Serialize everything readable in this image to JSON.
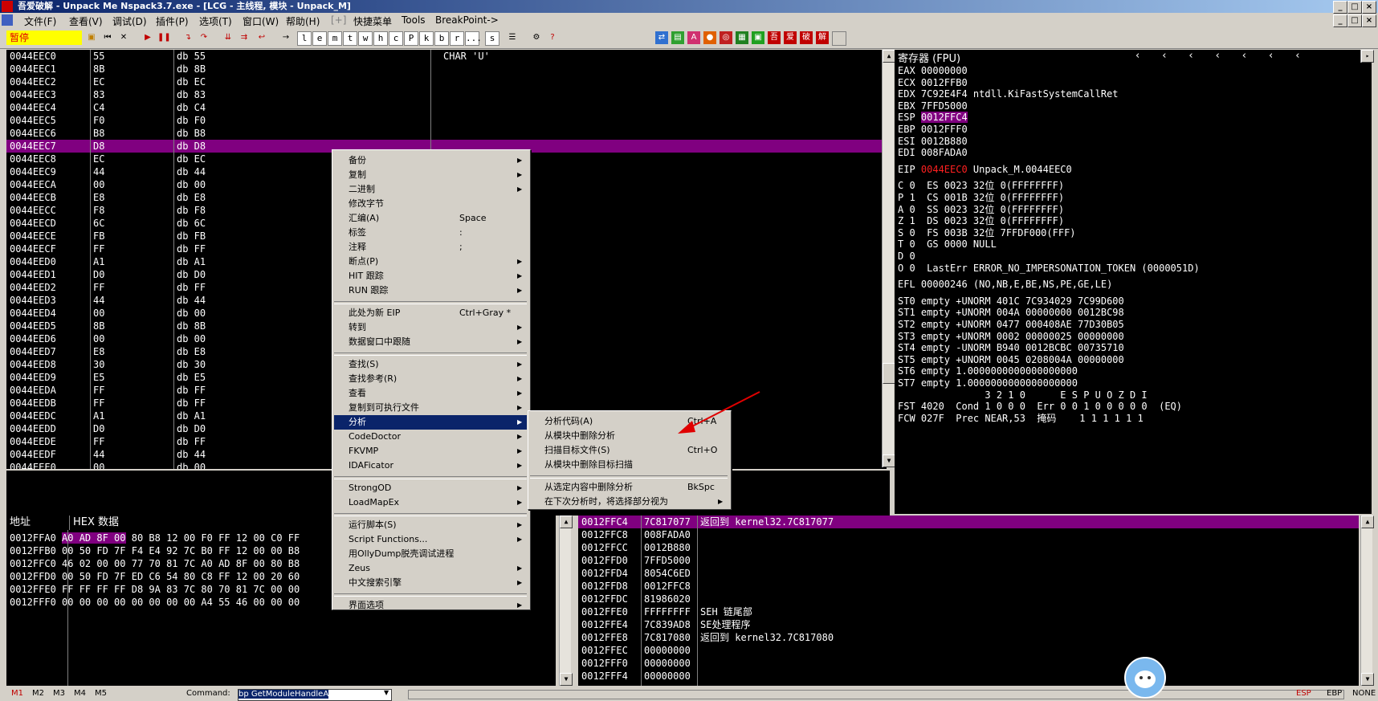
{
  "window": {
    "title": "吾爱破解 - Unpack Me Nspack3.7.exe - [LCG - 主线程, 模块 - Unpack_M]"
  },
  "menu": [
    "文件(F)",
    "查看(V)",
    "调试(D)",
    "插件(P)",
    "选项(T)",
    "窗口(W)",
    "帮助(H)",
    "[+]",
    "快捷菜单",
    "Tools",
    "BreakPoint->"
  ],
  "toolbar": {
    "status": "暂停",
    "letters": [
      "l",
      "e",
      "m",
      "t",
      "w",
      "h",
      "c",
      "P",
      "k",
      "b",
      "r",
      "...",
      "s"
    ]
  },
  "cpu": {
    "rows": [
      {
        "addr": "0044EEC0",
        "hex": "55",
        "dis": "db 55",
        "cmt": "CHAR 'U'"
      },
      {
        "addr": "0044EEC1",
        "hex": "8B",
        "dis": "db 8B",
        "cmt": ""
      },
      {
        "addr": "0044EEC2",
        "hex": "EC",
        "dis": "db EC",
        "cmt": ""
      },
      {
        "addr": "0044EEC3",
        "hex": "83",
        "dis": "db 83",
        "cmt": ""
      },
      {
        "addr": "0044EEC4",
        "hex": "C4",
        "dis": "db C4",
        "cmt": ""
      },
      {
        "addr": "0044EEC5",
        "hex": "F0",
        "dis": "db F0",
        "cmt": ""
      },
      {
        "addr": "0044EEC6",
        "hex": "B8",
        "dis": "db B8",
        "cmt": ""
      },
      {
        "addr": "0044EEC7",
        "hex": "D8",
        "dis": "db D8",
        "cmt": ""
      },
      {
        "addr": "0044EEC8",
        "hex": "EC",
        "dis": "db EC",
        "cmt": ""
      },
      {
        "addr": "0044EEC9",
        "hex": "44",
        "dis": "db 44",
        "cmt": ""
      },
      {
        "addr": "0044EECA",
        "hex": "00",
        "dis": "db 00",
        "cmt": ""
      },
      {
        "addr": "0044EECB",
        "hex": "E8",
        "dis": "db E8",
        "cmt": ""
      },
      {
        "addr": "0044EECC",
        "hex": "F8",
        "dis": "db F8",
        "cmt": ""
      },
      {
        "addr": "0044EECD",
        "hex": "6C",
        "dis": "db 6C",
        "cmt": ""
      },
      {
        "addr": "0044EECE",
        "hex": "FB",
        "dis": "db FB",
        "cmt": ""
      },
      {
        "addr": "0044EECF",
        "hex": "FF",
        "dis": "db FF",
        "cmt": ""
      },
      {
        "addr": "0044EED0",
        "hex": "A1",
        "dis": "db A1",
        "cmt": ""
      },
      {
        "addr": "0044EED1",
        "hex": "D0",
        "dis": "db D0",
        "cmt": ""
      },
      {
        "addr": "0044EED2",
        "hex": "FF",
        "dis": "db FF",
        "cmt": ""
      },
      {
        "addr": "0044EED3",
        "hex": "44",
        "dis": "db 44",
        "cmt": ""
      },
      {
        "addr": "0044EED4",
        "hex": "00",
        "dis": "db 00",
        "cmt": ""
      },
      {
        "addr": "0044EED5",
        "hex": "8B",
        "dis": "db 8B",
        "cmt": ""
      },
      {
        "addr": "0044EED6",
        "hex": "00",
        "dis": "db 00",
        "cmt": ""
      },
      {
        "addr": "0044EED7",
        "hex": "E8",
        "dis": "db E8",
        "cmt": ""
      },
      {
        "addr": "0044EED8",
        "hex": "30",
        "dis": "db 30",
        "cmt": ""
      },
      {
        "addr": "0044EED9",
        "hex": "E5",
        "dis": "db E5",
        "cmt": ""
      },
      {
        "addr": "0044EEDA",
        "hex": "FF",
        "dis": "db FF",
        "cmt": ""
      },
      {
        "addr": "0044EEDB",
        "hex": "FF",
        "dis": "db FF",
        "cmt": ""
      },
      {
        "addr": "0044EEDC",
        "hex": "A1",
        "dis": "db A1",
        "cmt": ""
      },
      {
        "addr": "0044EEDD",
        "hex": "D0",
        "dis": "db D0",
        "cmt": ""
      },
      {
        "addr": "0044EEDE",
        "hex": "FF",
        "dis": "db FF",
        "cmt": ""
      },
      {
        "addr": "0044EEDF",
        "hex": "44",
        "dis": "db 44",
        "cmt": ""
      },
      {
        "addr": "0044EEE0",
        "hex": "00",
        "dis": "db 00",
        "cmt": ""
      }
    ],
    "selected_index": 7
  },
  "registers": {
    "header": "寄存器 (FPU)",
    "lines": [
      "EAX 00000000",
      "ECX 0012FFB0",
      "EDX 7C92E4F4 ntdll.KiFastSystemCallRet",
      "EBX 7FFD5000",
      "ESP 0012FFC4",
      "EBP 0012FFF0",
      "ESI 0012B880",
      "EDI 008FADA0",
      "",
      "EIP 0044EEC0 Unpack_M.0044EEC0",
      "",
      "C 0  ES 0023 32位 0(FFFFFFFF)",
      "P 1  CS 001B 32位 0(FFFFFFFF)",
      "A 0  SS 0023 32位 0(FFFFFFFF)",
      "Z 1  DS 0023 32位 0(FFFFFFFF)",
      "S 0  FS 003B 32位 7FFDF000(FFF)",
      "T 0  GS 0000 NULL",
      "D 0",
      "O 0  LastErr ERROR_NO_IMPERSONATION_TOKEN (0000051D)",
      "",
      "EFL 00000246 (NO,NB,E,BE,NS,PE,GE,LE)",
      "",
      "ST0 empty +UNORM 401C 7C934029 7C99D600",
      "ST1 empty +UNORM 004A 00000000 0012BC98",
      "ST2 empty +UNORM 0477 000408AE 77D30B05",
      "ST3 empty +UNORM 0002 00000025 00000000",
      "ST4 empty -UNORM B940 0012BCBC 00735710",
      "ST5 empty +UNORM 0045 0208004A 00000000",
      "ST6 empty 1.0000000000000000000",
      "ST7 empty 1.0000000000000000000",
      "               3 2 1 0      E S P U O Z D I",
      "FST 4020  Cond 1 0 0 0  Err 0 0 1 0 0 0 0 0  (EQ)",
      "FCW 027F  Prec NEAR,53  掩码    1 1 1 1 1 1"
    ]
  },
  "dump": {
    "col_addr": "地址",
    "col_hex": "HEX 数据",
    "rows": [
      "0012FFA0 A0 AD 8F 00 80 B8 12 00 F0 FF 12 00 C0 FF",
      "0012FFB0 00 50 FD 7F F4 E4 92 7C B0 FF 12 00 00 B8",
      "0012FFC0 46 02 00 00 77 70 81 7C A0 AD 8F 00 80 B8",
      "0012FFD0 00 50 FD 7F ED C6 54 80 C8 FF 12 00 20 60",
      "0012FFE0 FF FF FF FF D8 9A 83 7C 80 70 81 7C 00 00",
      "0012FFF0 00 00 00 00 00 00 00 00 A4 55 46 00 00 00"
    ]
  },
  "stack": {
    "rows": [
      {
        "addr": "0012FFC4",
        "val": "7C817077",
        "cmt": "返回到 kernel32.7C817077"
      },
      {
        "addr": "0012FFC8",
        "val": "008FADA0",
        "cmt": ""
      },
      {
        "addr": "0012FFCC",
        "val": "0012B880",
        "cmt": ""
      },
      {
        "addr": "0012FFD0",
        "val": "7FFD5000",
        "cmt": ""
      },
      {
        "addr": "0012FFD4",
        "val": "8054C6ED",
        "cmt": ""
      },
      {
        "addr": "0012FFD8",
        "val": "0012FFC8",
        "cmt": ""
      },
      {
        "addr": "0012FFDC",
        "val": "81986020",
        "cmt": ""
      },
      {
        "addr": "0012FFE0",
        "val": "FFFFFFFF",
        "cmt": "SEH 链尾部"
      },
      {
        "addr": "0012FFE4",
        "val": "7C839AD8",
        "cmt": "SE处理程序"
      },
      {
        "addr": "0012FFE8",
        "val": "7C817080",
        "cmt": "返回到 kernel32.7C817080"
      },
      {
        "addr": "0012FFEC",
        "val": "00000000",
        "cmt": ""
      },
      {
        "addr": "0012FFF0",
        "val": "00000000",
        "cmt": ""
      },
      {
        "addr": "0012FFF4",
        "val": "00000000",
        "cmt": ""
      }
    ]
  },
  "context_menu": {
    "items": [
      {
        "label": "备份",
        "shortcut": "",
        "sub": true
      },
      {
        "label": "复制",
        "shortcut": "",
        "sub": true
      },
      {
        "label": "二进制",
        "shortcut": "",
        "sub": true
      },
      {
        "label": "修改字节",
        "shortcut": "",
        "sub": false
      },
      {
        "label": "汇编(A)",
        "shortcut": "Space",
        "sub": false
      },
      {
        "label": "标签",
        "shortcut": ":",
        "sub": false
      },
      {
        "label": "注释",
        "shortcut": ";",
        "sub": false
      },
      {
        "label": "断点(P)",
        "shortcut": "",
        "sub": true
      },
      {
        "label": "HIT 跟踪",
        "shortcut": "",
        "sub": true
      },
      {
        "label": "RUN 跟踪",
        "shortcut": "",
        "sub": true
      },
      {
        "sep": true
      },
      {
        "label": "此处为新 EIP",
        "shortcut": "Ctrl+Gray *",
        "sub": false
      },
      {
        "label": "转到",
        "shortcut": "",
        "sub": true
      },
      {
        "label": "数据窗口中跟随",
        "shortcut": "",
        "sub": true
      },
      {
        "sep": true
      },
      {
        "label": "查找(S)",
        "shortcut": "",
        "sub": true
      },
      {
        "label": "查找参考(R)",
        "shortcut": "",
        "sub": true
      },
      {
        "label": "查看",
        "shortcut": "",
        "sub": true
      },
      {
        "label": "复制到可执行文件",
        "shortcut": "",
        "sub": true
      },
      {
        "label": "分析",
        "shortcut": "",
        "sub": true,
        "highlight": true
      },
      {
        "label": "CodeDoctor",
        "shortcut": "",
        "sub": true
      },
      {
        "label": "FKVMP",
        "shortcut": "",
        "sub": true
      },
      {
        "label": "IDAFicator",
        "shortcut": "",
        "sub": true
      },
      {
        "sep": true
      },
      {
        "label": "StrongOD",
        "shortcut": "",
        "sub": true
      },
      {
        "label": "LoadMapEx",
        "shortcut": "",
        "sub": true
      },
      {
        "sep": true
      },
      {
        "label": "运行脚本(S)",
        "shortcut": "",
        "sub": true
      },
      {
        "label": "Script Functions...",
        "shortcut": "",
        "sub": true
      },
      {
        "label": "用OllyDump脱壳调试进程",
        "shortcut": "",
        "sub": false
      },
      {
        "label": "Zeus",
        "shortcut": "",
        "sub": true
      },
      {
        "label": "中文搜索引擎",
        "shortcut": "",
        "sub": true
      },
      {
        "sep": true
      },
      {
        "label": "界面选项",
        "shortcut": "",
        "sub": true
      }
    ]
  },
  "submenu": {
    "items": [
      {
        "label": "分析代码(A)",
        "shortcut": "Ctrl+A",
        "sub": false
      },
      {
        "label": "从模块中删除分析",
        "shortcut": "",
        "sub": false
      },
      {
        "label": "扫描目标文件(S)",
        "shortcut": "Ctrl+O",
        "sub": false
      },
      {
        "label": "从模块中删除目标扫描",
        "shortcut": "",
        "sub": false
      },
      {
        "sep": true
      },
      {
        "label": "从选定内容中删除分析",
        "shortcut": "BkSpc",
        "sub": false
      },
      {
        "label": "在下次分析时，将选择部分视为",
        "shortcut": "",
        "sub": true
      }
    ]
  },
  "statusbar": {
    "tabs": [
      "M1",
      "M2",
      "M3",
      "M4",
      "M5"
    ],
    "command_label": "Command:",
    "command_value": "bp GetModuleHandleA",
    "right": [
      "ESP",
      "EBP",
      "NONE"
    ]
  },
  "colors": {
    "selection": "#800080",
    "menu_highlight": "#0a246a",
    "eip_red": "#ff2020",
    "pause_bg": "#ffff00"
  }
}
